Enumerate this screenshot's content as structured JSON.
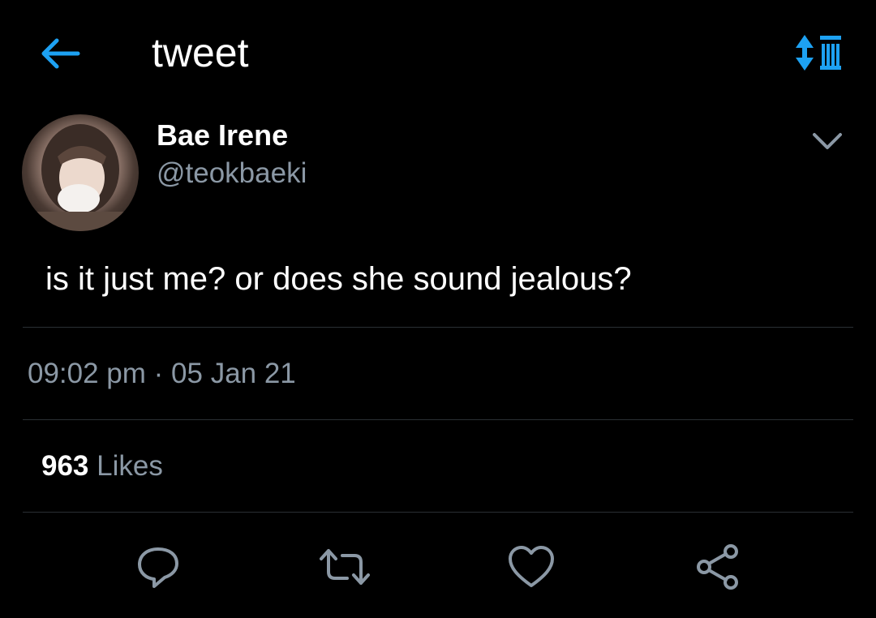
{
  "header": {
    "title": "tweet",
    "back_icon": "arrow-left-icon",
    "sort_icon": "sort-toggle-icon"
  },
  "author": {
    "name": "Bae Irene",
    "handle": "@teokbaeki",
    "avatar": "profile-photo",
    "more_icon": "chevron-down-icon"
  },
  "tweet": {
    "text": "is it just me? or does she sound jealous?",
    "timestamp": "09:02 pm · 05 Jan 21"
  },
  "stats": {
    "likes_count": "963",
    "likes_label": "Likes"
  },
  "actions": [
    {
      "name": "reply",
      "icon": "comment-icon"
    },
    {
      "name": "retweet",
      "icon": "retweet-icon"
    },
    {
      "name": "like",
      "icon": "heart-icon"
    },
    {
      "name": "share",
      "icon": "share-icon"
    }
  ],
  "colors": {
    "background": "#000000",
    "accent": "#1da1f2",
    "secondary_text": "#8b98a5",
    "icon_gray": "#8b98a5",
    "divider": "#2a2f33"
  }
}
